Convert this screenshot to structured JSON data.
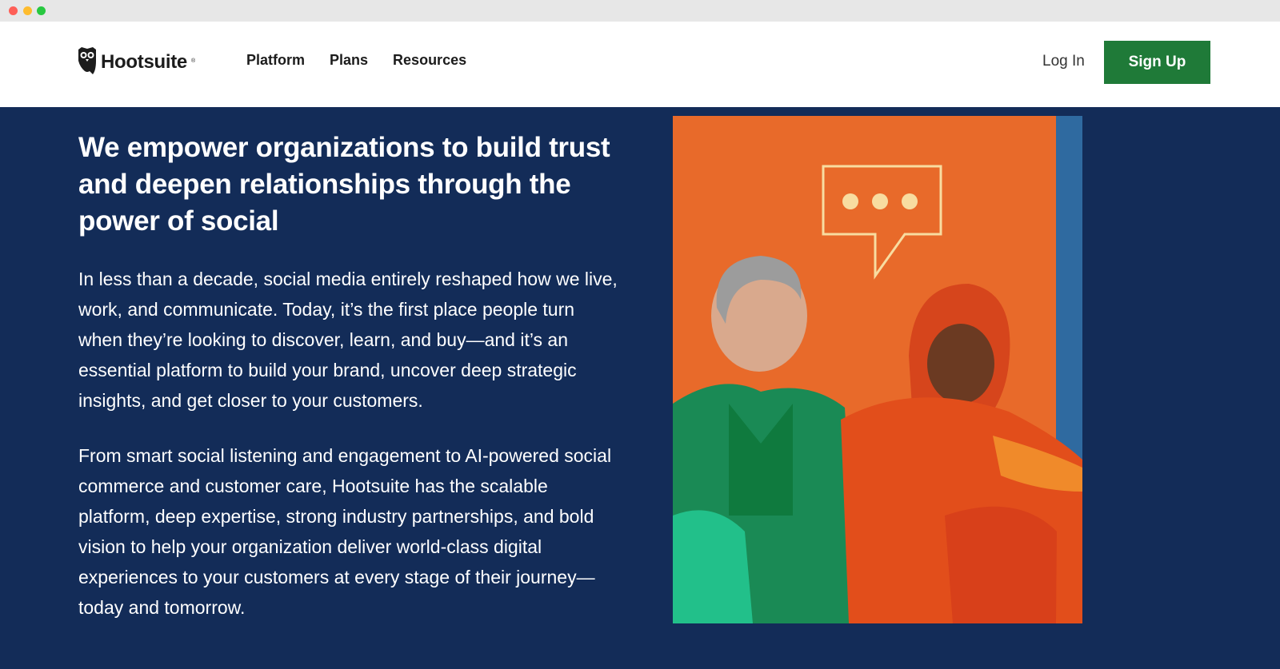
{
  "header": {
    "logo_text": "Hootsuite",
    "logo_mark": "®",
    "nav": [
      {
        "label": "Platform"
      },
      {
        "label": "Plans"
      },
      {
        "label": "Resources"
      }
    ],
    "login_label": "Log In",
    "signup_label": "Sign Up"
  },
  "hero": {
    "title": "We empower organizations to build trust and deepen relationships through the power of social",
    "paragraph1": "In less than a decade, social media entirely reshaped how we live, work, and communicate. Today, it’s the first place people turn when they’re looking to discover, learn, and buy—and it’s an essential platform to build your brand, uncover deep strategic insights, and get closer to your customers.",
    "paragraph2": "From smart social listening and engagement to AI-powered social commerce and customer care, Hootsuite has the scalable platform, deep expertise, strong industry partnerships, and bold vision to help your organization deliver world-class digital experiences to your customers at every stage of their journey—today and tomorrow."
  },
  "colors": {
    "hero_bg": "#132c58",
    "signup_bg": "#1f7a38",
    "photo_orange": "#e86a2a",
    "photo_blue": "#2f6aa0"
  },
  "icons": {
    "logo": "owl-icon",
    "photo_overlay": "speech-bubble-icon"
  }
}
